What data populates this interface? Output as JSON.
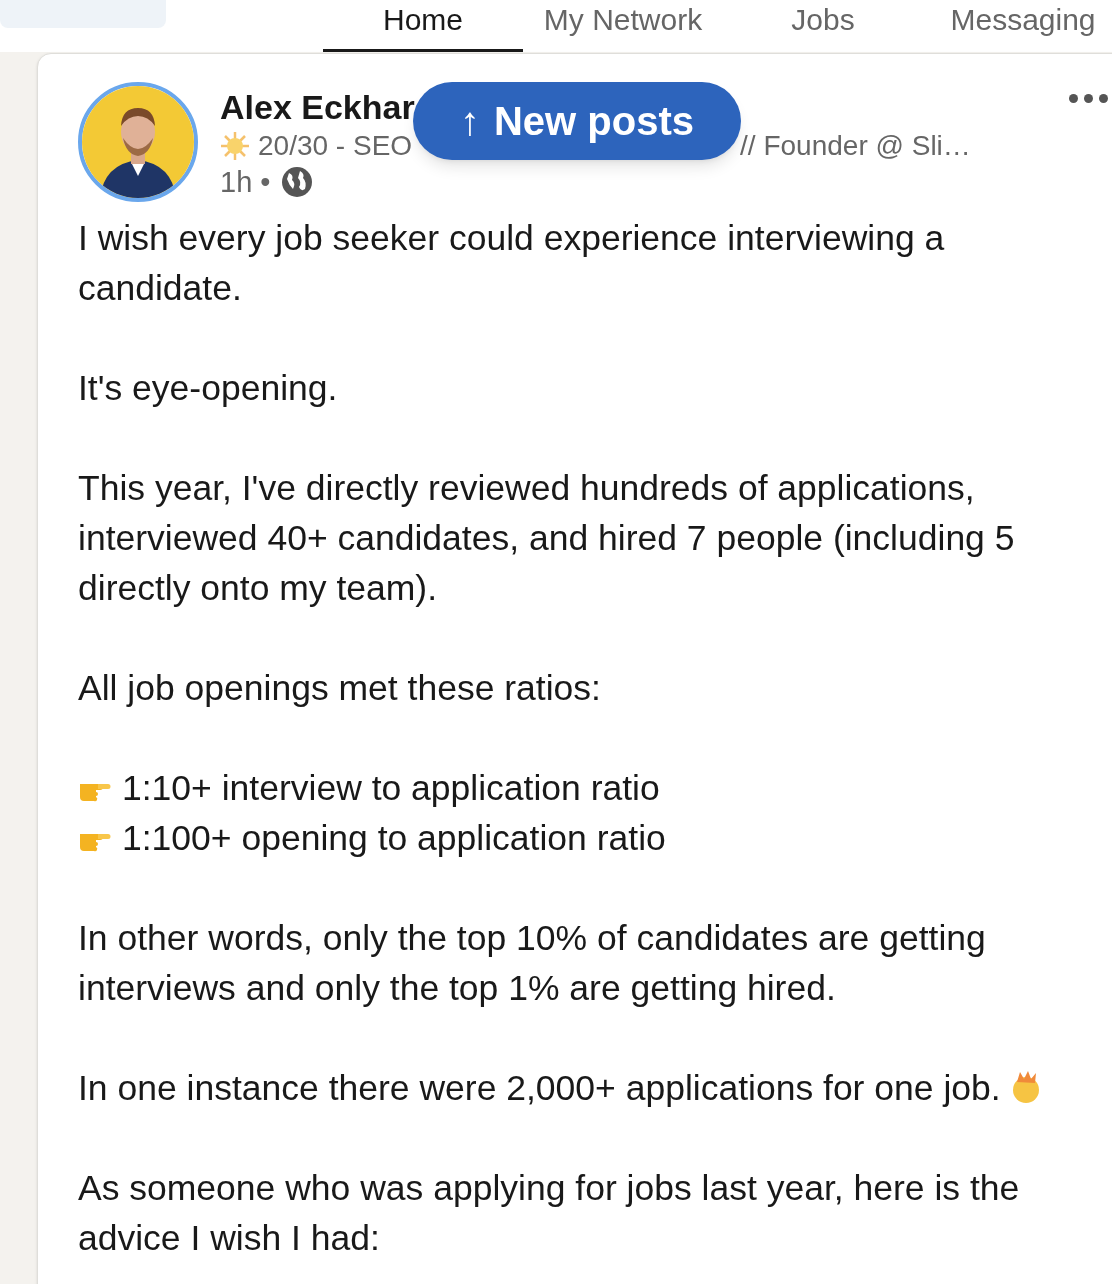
{
  "nav": {
    "tabs": [
      {
        "label": "Home",
        "selected": true
      },
      {
        "label": "My Network",
        "selected": false
      },
      {
        "label": "Jobs",
        "selected": false
      },
      {
        "label": "Messaging",
        "selected": false
      }
    ]
  },
  "new_posts_button": {
    "arrow": "↑",
    "label": "New posts"
  },
  "post": {
    "author": "Alex Eckhar",
    "headline_start": "20/30 - SEO",
    "headline_end": "// Founder @ Sli…",
    "time": "1h •",
    "body": [
      {
        "kind": "paragraph",
        "text": "I wish every job seeker could experience interviewing a candidate."
      },
      {
        "kind": "paragraph",
        "text": "It's eye-opening."
      },
      {
        "kind": "paragraph",
        "text": "This year, I've directly reviewed hundreds of applications, interviewed 40+ candidates, and hired 7 people (including 5 directly onto my team)."
      },
      {
        "kind": "paragraph",
        "text": "All job openings met these ratios:"
      },
      {
        "kind": "bullets",
        "items": [
          "1:10+ interview to application ratio",
          "1:100+ opening to application ratio"
        ]
      },
      {
        "kind": "paragraph",
        "text": "In other words, only the top 10% of candidates are getting interviews and only the top 1% are getting hired."
      },
      {
        "kind": "paragraph",
        "text": "In one instance there were 2,000+ applications for one job.",
        "emoji": true
      },
      {
        "kind": "paragraph",
        "text": "As someone who was applying for jobs last year, here is the advice I wish I had:"
      }
    ]
  }
}
